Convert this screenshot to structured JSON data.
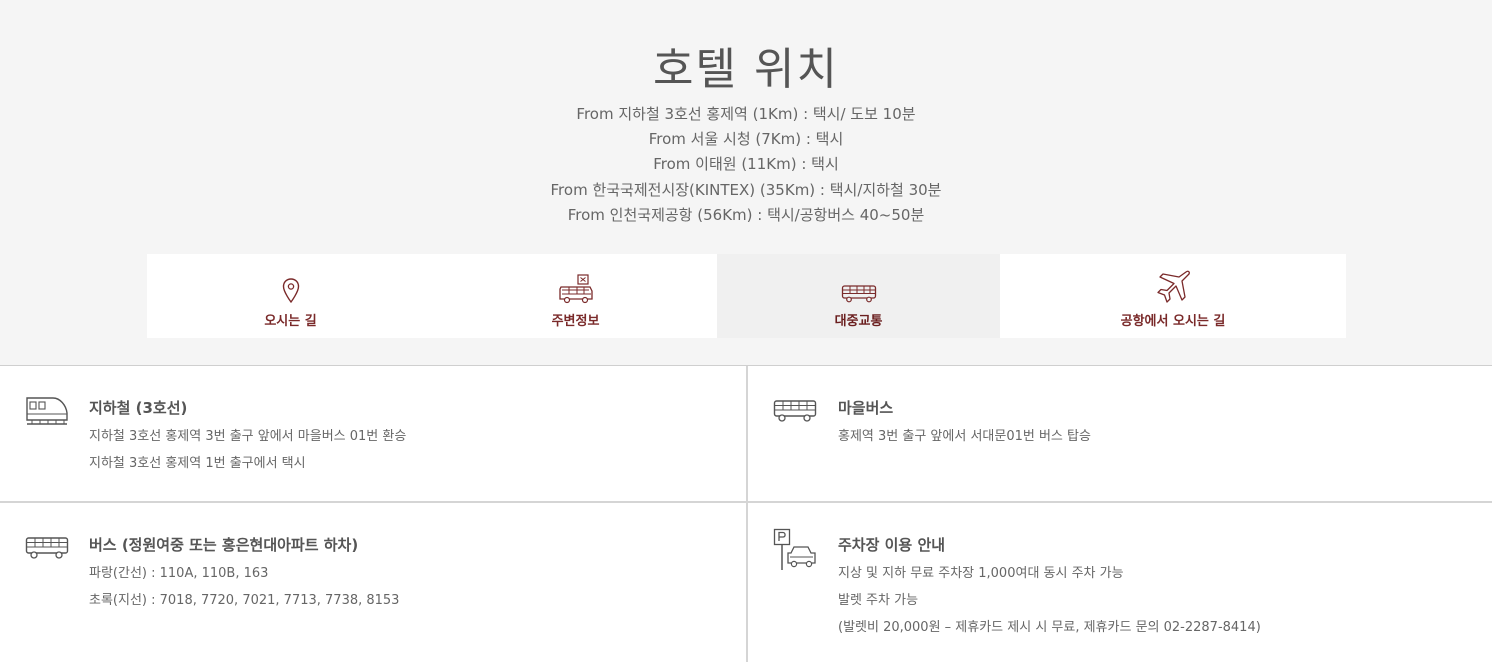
{
  "page": {
    "title": "호텔 위치",
    "routes": [
      "From 지하철 3호선 홍제역 (1Km) : 택시/  도보 10분",
      "From 서울 시청 (7Km) :  택시",
      "From 이태원 (11Km) : 택시",
      "From 한국국제전시장(KINTEX) (35Km) :  택시/지하철 30분",
      "From 인천국제공항 (56Km) :  택시/공항버스 40~50분"
    ]
  },
  "tabs": [
    {
      "label": "오시는 길",
      "icon": "map-pin-icon",
      "active": false
    },
    {
      "label": "주변정보",
      "icon": "bus-map-icon",
      "active": false
    },
    {
      "label": "대중교통",
      "icon": "bus-icon",
      "active": true
    },
    {
      "label": "공항에서 오시는 길",
      "icon": "airplane-icon",
      "active": false
    }
  ],
  "transport": {
    "subway": {
      "title": "지하철 (3호선)",
      "lines": [
        "지하철 3호선 홍제역 3번 출구 앞에서 마을버스 01번 환승",
        "지하철 3호선 홍제역 1번 출구에서 택시"
      ]
    },
    "village_bus": {
      "title": "마을버스",
      "lines": [
        "홍제역 3번 출구 앞에서 서대문01번 버스 탑승"
      ]
    },
    "bus": {
      "title": "버스 (정원여중 또는 홍은현대아파트 하차)",
      "lines": [
        "파랑(간선) : 110A, 110B, 163",
        "초록(지선) : 7018, 7720, 7021, 7713, 7738, 8153"
      ]
    },
    "parking": {
      "title": "주차장 이용 안내",
      "lines": [
        "지상 및 지하 무료 주차장 1,000여대 동시 주차 가능",
        "발렛 주차 가능",
        "(발렛비 20,000원 – 제휴카드 제시 시 무료, 제휴카드 문의 02-2287-8414)"
      ]
    }
  },
  "colors": {
    "accent": "#7a2a2a",
    "hero_bg": "#f5f5f5",
    "active_tab_bg": "#f0f0f0",
    "text": "#555555"
  }
}
